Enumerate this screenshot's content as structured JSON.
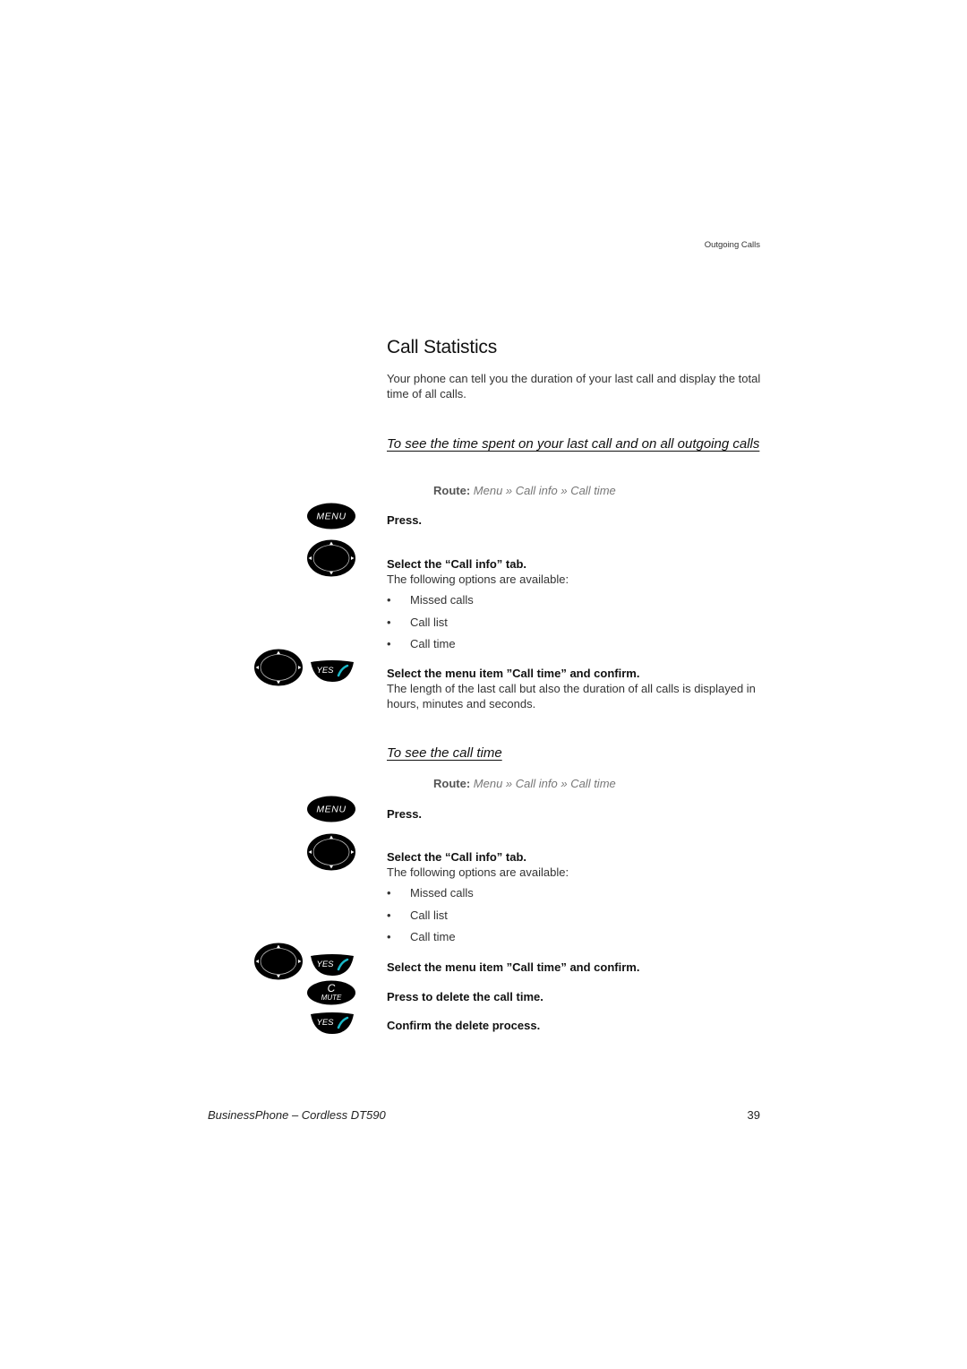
{
  "header": {
    "section": "Outgoing Calls"
  },
  "title": "Call Statistics",
  "intro": "Your phone can tell you the duration of your last call and display the total time of all calls.",
  "sections": [
    {
      "subheading": "To see the time spent on your last call and on all outgoing calls",
      "route": {
        "label": "Route:",
        "path": "Menu » Call info » Call time"
      },
      "steps": [
        {
          "icon": "menu-key",
          "icon_label": "MENU",
          "bold": "Press."
        },
        {
          "icon": "navigation-key",
          "bold": "Select the “Call info” tab.",
          "text": "The following options are available:",
          "bullets": [
            "Missed calls",
            "Call list",
            "Call time"
          ]
        },
        {
          "icons": [
            "navigation-key",
            "yes-key"
          ],
          "icon_label": "YES",
          "bold": "Select the menu item ”Call time” and confirm.",
          "text": "The length of the last call but also the duration of all calls is displayed in hours, minutes and seconds."
        }
      ]
    },
    {
      "subheading": "To see the call time",
      "route": {
        "label": "Route:",
        "path": "Menu » Call info » Call time"
      },
      "steps": [
        {
          "icon": "menu-key",
          "icon_label": "MENU",
          "bold": "Press."
        },
        {
          "icon": "navigation-key",
          "bold": "Select the “Call info” tab.",
          "text": "The following options are available:",
          "bullets": [
            "Missed calls",
            "Call list",
            "Call time"
          ]
        },
        {
          "icons": [
            "navigation-key",
            "yes-key"
          ],
          "icon_label": "YES",
          "bold": "Select the menu item ”Call time” and confirm."
        },
        {
          "icon": "c-mute-key",
          "icon_label_top": "C",
          "icon_label_bottom": "MUTE",
          "bold": "Press to delete the call time."
        },
        {
          "icon": "yes-key",
          "icon_label": "YES",
          "bold": "Confirm the delete process."
        }
      ]
    }
  ],
  "footer": {
    "product": "BusinessPhone – Cordless DT590",
    "page_number": "39"
  },
  "colors": {
    "phone_icon": "#1ab8c8",
    "key_fill": "#000000"
  }
}
